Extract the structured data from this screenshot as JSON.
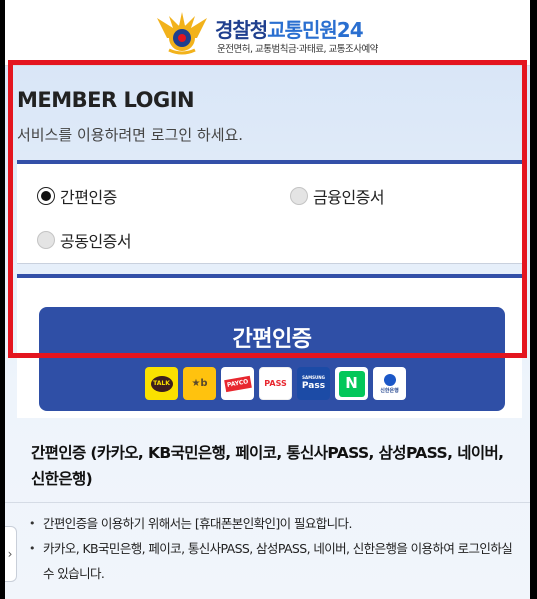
{
  "header": {
    "brand_main": "경찰청",
    "brand_accent": "교통민원24",
    "subtitle": "운전면허, 교통범칙금·과태료, 교통조사예약"
  },
  "login": {
    "title": "MEMBER LOGIN",
    "description": "서비스를 이용하려면 로그인 하세요.",
    "options": [
      {
        "label": "간편인증",
        "selected": true
      },
      {
        "label": "금융인증서",
        "selected": false
      },
      {
        "label": "공동인증서",
        "selected": false
      }
    ],
    "auth_button_label": "간편인증",
    "providers": [
      {
        "name": "kakao-icon",
        "text": "TALK"
      },
      {
        "name": "kb-icon",
        "text": "★b"
      },
      {
        "name": "payco-icon",
        "text": "PAYCO"
      },
      {
        "name": "pass-icon",
        "text": "PASS"
      },
      {
        "name": "samsung-pass-icon",
        "text_small": "SAMSUNG",
        "text": "Pass"
      },
      {
        "name": "naver-icon",
        "text": "N"
      },
      {
        "name": "shinhan-icon",
        "text": "신한은행"
      }
    ]
  },
  "info": {
    "title": "간편인증 (카카오, KB국민은행, 페이코, 통신사PASS, 삼성PASS, 네이버, 신한은행)",
    "bullets": [
      "간편인증을 이용하기 위해서는 [휴대폰본인확인]이 필요합니다.",
      "카카오, KB국민은행, 페이코, 통신사PASS, 삼성PASS, 네이버, 신한은행을 이용하여 로그인하실 수 있습니다."
    ]
  },
  "colors": {
    "primary": "#2f4fa6",
    "highlight": "#e4151f",
    "brand_blue": "#2a6fd0"
  },
  "side_tab_icon": "chevron-right-icon"
}
